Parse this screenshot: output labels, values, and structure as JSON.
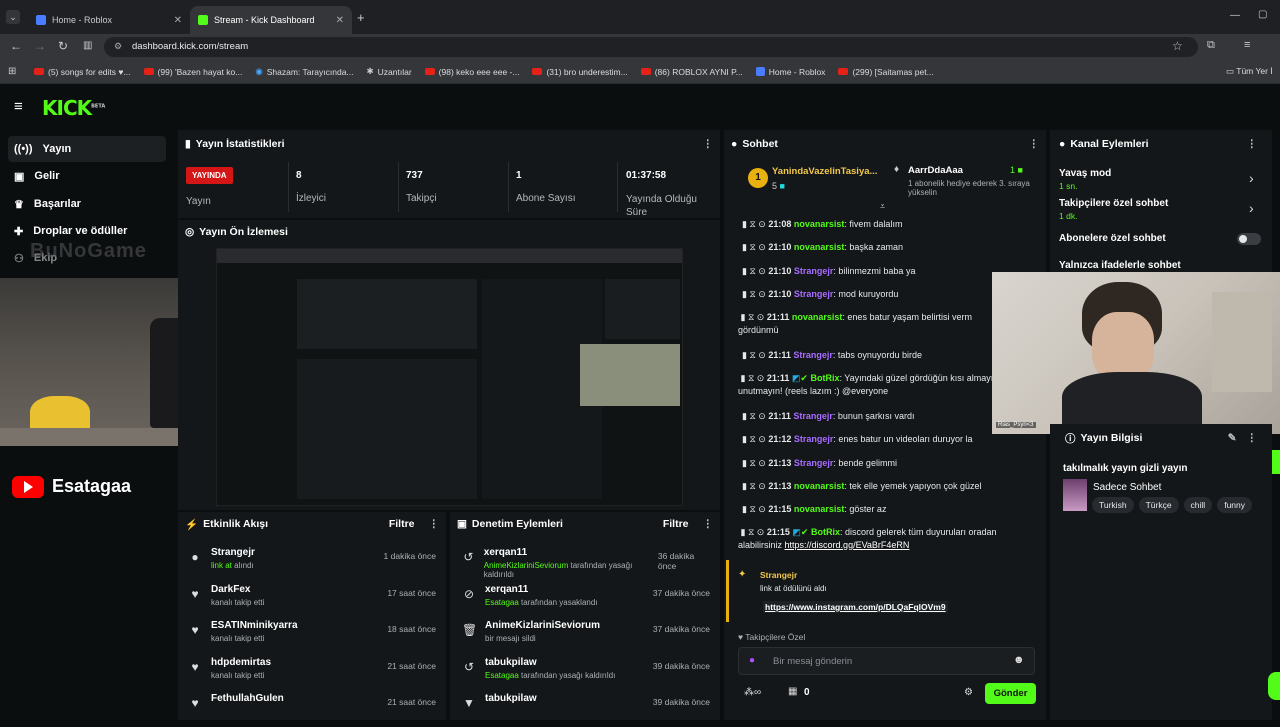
{
  "browser": {
    "tabs": [
      {
        "title": "Home - Roblox",
        "active": false
      },
      {
        "title": "Stream - Kick Dashboard",
        "active": true
      }
    ],
    "url": "dashboard.kick.com/stream",
    "bookmarks": [
      "(5) songs for edits ♥...",
      "(99) 'Bazen hayat ko...",
      "Shazam: Tarayıcında...",
      "Uzantılar",
      "(98) keko eee eee -...",
      "(31) bro underestim...",
      "(86) ROBLOX AYNI P...",
      "Home - Roblox",
      "(299) [Saitamas pet..."
    ],
    "bookmarks_folder": "Tüm Yer İ"
  },
  "app": {
    "logo": "KICK",
    "logo_sup": "BETA",
    "nav": [
      {
        "label": "Yayın",
        "icon": "broadcast-icon",
        "active": true
      },
      {
        "label": "Gelir",
        "icon": "money-icon",
        "active": false
      },
      {
        "label": "Başarılar",
        "icon": "trophy-icon",
        "active": false
      },
      {
        "label": "Droplar ve ödüller",
        "icon": "gift-icon",
        "active": false
      },
      {
        "label": "Ekip",
        "icon": "team-icon",
        "active": false
      }
    ],
    "overlay_text": "BuNoGame",
    "youtube_channel": "Esatagaa"
  },
  "stats": {
    "title": "Yayın İstatistikleri",
    "live_badge": "YAYINDA",
    "live_label": "Yayın",
    "items": [
      {
        "value": "8",
        "label": "İzleyici"
      },
      {
        "value": "737",
        "label": "Takipçi"
      },
      {
        "value": "1",
        "label": "Abone Sayısı"
      },
      {
        "value": "01:37:58",
        "label": "Yayında Olduğu Süre"
      }
    ]
  },
  "preview": {
    "title": "Yayın Ön İzlemesi"
  },
  "activity": {
    "title": "Etkinlik Akışı",
    "filter": "Filtre",
    "items": [
      {
        "name": "Strangejr",
        "sub1": "link at",
        "sub2": " alındı",
        "time": "1 dakika önce",
        "icon": "reward-icon"
      },
      {
        "name": "DarkFex",
        "sub1": "",
        "sub2": "kanalı takip etti",
        "time": "17 saat önce",
        "icon": "heart-icon"
      },
      {
        "name": "ESATINminikyarra",
        "sub1": "",
        "sub2": "kanalı takip etti",
        "time": "18 saat önce",
        "icon": "heart-icon"
      },
      {
        "name": "hdpdemirtas",
        "sub1": "",
        "sub2": "kanalı takip etti",
        "time": "21 saat önce",
        "icon": "heart-icon"
      },
      {
        "name": "FethullahGulen",
        "sub1": "",
        "sub2": "",
        "time": "21 saat önce",
        "icon": "heart-icon"
      }
    ]
  },
  "moderation": {
    "title": "Denetim Eylemleri",
    "filter": "Filtre",
    "items": [
      {
        "name": "xerqan11",
        "sub1": "AnimeKizlariniSeviorum",
        "sub2": " tarafından yasağı kaldırıldı",
        "time": "36 dakika önce",
        "icon": "undo-icon"
      },
      {
        "name": "xerqan11",
        "sub1": "Esatagaa",
        "sub2": " tarafından yasaklandı",
        "time": "37 dakika önce",
        "icon": "ban-icon"
      },
      {
        "name": "AnimeKizlariniSeviorum",
        "sub1": "",
        "sub2": "bir mesajı sildi",
        "time": "37 dakika önce",
        "icon": "trash-icon"
      },
      {
        "name": "tabukpilaw",
        "sub1": "Esatagaa",
        "sub2": " tarafından yasağı kaldırıldı",
        "time": "39 dakika önce",
        "icon": "undo-icon"
      },
      {
        "name": "tabukpilaw",
        "sub1": "",
        "sub2": "",
        "time": "39 dakika önce",
        "icon": "filter-icon"
      }
    ]
  },
  "chat": {
    "title": "Sohbet",
    "pinned_user1": "YanindaVazelinTasiya...",
    "pinned_count1": "5",
    "pinned_user2": "AarrDdaAaa",
    "pinned_count2": "1",
    "pinned_note": "1 abonelik hediye ederek 3. sıraya yükselin",
    "messages": [
      {
        "time": "21:08",
        "user": "novanarsist",
        "color": "g",
        "text": ": fivem dalalım"
      },
      {
        "time": "21:10",
        "user": "novanarsist",
        "color": "g",
        "text": ": başka zaman"
      },
      {
        "time": "21:10",
        "user": "Strangejr",
        "color": "p",
        "text": ": bilinmezmi baba ya"
      },
      {
        "time": "21:10",
        "user": "Strangejr",
        "color": "p",
        "text": ": mod kuruyordu"
      },
      {
        "time": "21:11",
        "user": "novanarsist",
        "color": "g",
        "text": ": enes batur yaşam belirtisi verm gördünmü"
      },
      {
        "time": "21:11",
        "user": "Strangejr",
        "color": "p",
        "text": ": tabs oynuyordu birde"
      },
      {
        "time": "21:11",
        "user": "BotRix",
        "color": "b",
        "text": ": Yayındaki güzel gördüğün kısı almayı unutmayın! (reels lazım :) @everyone"
      },
      {
        "time": "21:11",
        "user": "Strangejr",
        "color": "p",
        "text": ": bunun şarkısı vardı"
      },
      {
        "time": "21:12",
        "user": "Strangejr",
        "color": "p",
        "text": ": enes batur un videoları duruyor la"
      },
      {
        "time": "21:13",
        "user": "Strangejr",
        "color": "p",
        "text": ": bende gelimmi"
      },
      {
        "time": "21:13",
        "user": "novanarsist",
        "color": "g",
        "text": ": tek elle yemek yapıyon çok güzel"
      },
      {
        "time": "21:15",
        "user": "novanarsist",
        "color": "g",
        "text": ": göster az"
      },
      {
        "time": "21:15",
        "user": "BotRix",
        "color": "b",
        "text": ": discord gelerek tüm duyuruları oradan alabilirsiniz "
      }
    ],
    "discord_link": "https://discord.gg/EVaBrF4eRN",
    "reward_user": "Strangejr",
    "reward_text": "link at ödülünü aldı",
    "reward_link": "https://www.instagram.com/p/DLQaFqlOVm9",
    "followers_only": "Takipçilere Özel",
    "input_placeholder": "Bir mesaj gönderin",
    "points": "0",
    "send": "Gönder"
  },
  "channel_actions": {
    "title": "Kanal Eylemleri",
    "slow_mode": "Yavaş mod",
    "slow_mode_value": "1 sn.",
    "followers_chat": "Takipçilere özel sohbet",
    "followers_chat_value": "1 dk.",
    "subs_chat": "Abonelere özel sohbet",
    "emote_chat": "Yalnızca ifadelerle sohbet"
  },
  "stream_info": {
    "title": "Yayın Bilgisi",
    "stream_title": "takılmalık yayın gizli yayın",
    "category": "Sadece Sohbet",
    "tags": [
      "Turkish",
      "Türkçe",
      "chill",
      "funny"
    ]
  },
  "webcam_label": "Rias_Psyn<3"
}
